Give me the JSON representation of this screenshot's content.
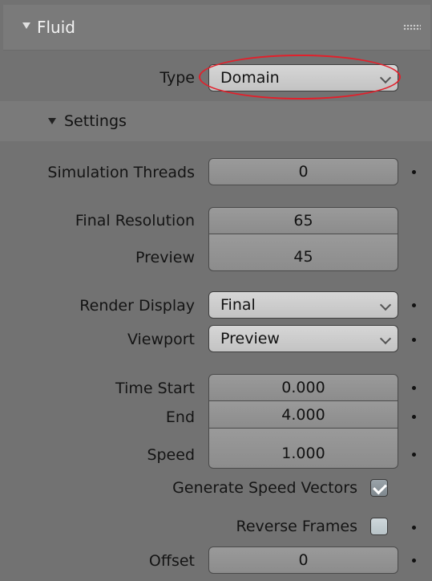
{
  "panel": {
    "title": "Fluid",
    "type_label": "Type",
    "type_value": "Domain"
  },
  "settings": {
    "title": "Settings",
    "simulation_threads_label": "Simulation Threads",
    "simulation_threads_value": "0",
    "final_resolution_label": "Final Resolution",
    "final_resolution_value": "65",
    "preview_label": "Preview",
    "preview_value": "45",
    "render_display_label": "Render Display",
    "render_display_value": "Final",
    "viewport_label": "Viewport",
    "viewport_value": "Preview",
    "time_start_label": "Time Start",
    "time_start_value": "0.000",
    "end_label": "End",
    "end_value": "4.000",
    "speed_label": "Speed",
    "speed_value": "1.000",
    "generate_speed_vectors_label": "Generate Speed Vectors",
    "generate_speed_vectors_checked": true,
    "reverse_frames_label": "Reverse Frames",
    "reverse_frames_checked": false,
    "offset_label": "Offset",
    "offset_value": "0"
  },
  "icons": {
    "expand": "triangle-down-icon",
    "grip": "drag-grip-icon",
    "dropdown": "chevron-down-icon",
    "keyframe": "dot-icon"
  },
  "colors": {
    "panel_bg": "#727272",
    "dropdown_bg": "#cfcfcf",
    "field_bg": "#929292",
    "annotation": "#e2202b"
  }
}
